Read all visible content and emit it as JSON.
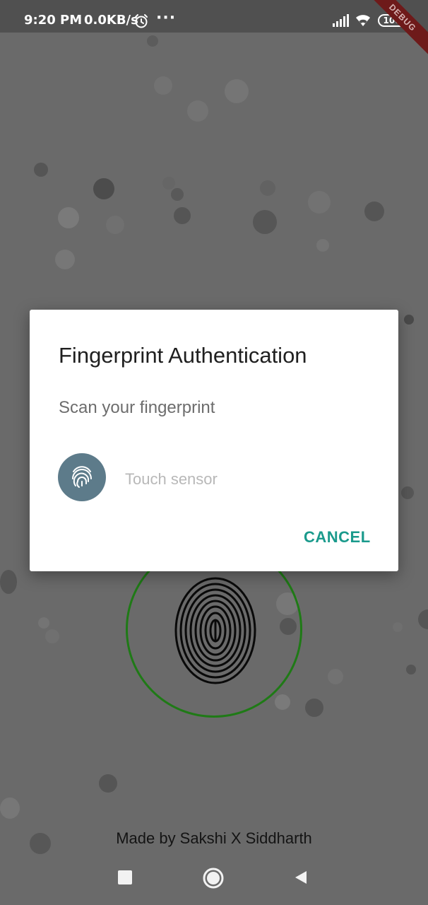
{
  "status_bar": {
    "time": "9:20 PM",
    "network_speed": "0.0KB/s",
    "more_indicator": "···",
    "battery_level": "100",
    "icons": [
      "alarm-icon",
      "signal-icon",
      "wifi-icon",
      "battery-icon"
    ]
  },
  "debug_banner": {
    "label": "DEBUG"
  },
  "dialog": {
    "title": "Fingerprint Authentication",
    "subtitle": "Scan your fingerprint",
    "sensor_hint": "Touch sensor",
    "cancel_label": "CANCEL",
    "icon": "fingerprint-icon"
  },
  "background": {
    "ring_color": "#1f7a16",
    "fingerprint_icon": "fingerprint-icon"
  },
  "footer": {
    "credit": "Made by Sakshi X Siddharth"
  },
  "nav_bar": {
    "icons": [
      "recent-apps-icon",
      "home-icon",
      "back-icon"
    ]
  },
  "colors": {
    "scrim": "#6a6a6a",
    "accent": "#1a9a8c",
    "fingerprint_badge": "#5d7b8a"
  }
}
